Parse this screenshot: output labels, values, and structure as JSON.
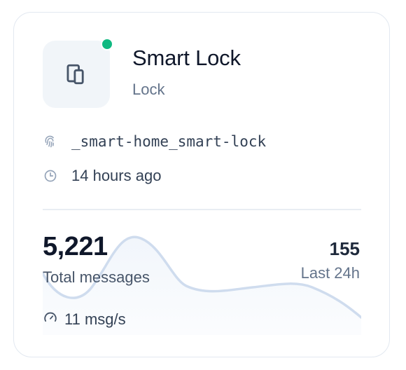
{
  "device": {
    "name": "Smart Lock",
    "type": "Lock",
    "status_color": "#10b981",
    "icon": "devices-icon"
  },
  "meta": {
    "id": "_smart-home_smart-lock",
    "id_icon": "fingerprint-icon",
    "last_seen": "14 hours ago",
    "last_seen_icon": "clock-icon"
  },
  "stats": {
    "total_messages": "5,221",
    "total_label": "Total messages",
    "last_24h_count": "155",
    "last_24h_label": "Last 24h",
    "rate": "11 msg/s",
    "rate_icon": "gauge-icon"
  },
  "colors": {
    "sparkline": "#cfdcee",
    "accent_text": "#0f172a"
  }
}
